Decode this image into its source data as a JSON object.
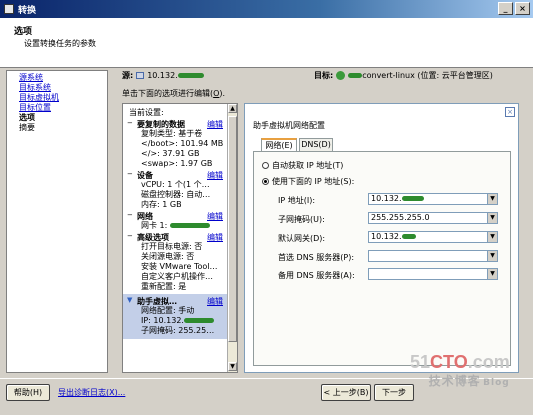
{
  "window": {
    "title": "转换"
  },
  "header": {
    "title": "选项",
    "subtitle": "设置转换任务的参数"
  },
  "nav": {
    "items": [
      {
        "label": "源系统",
        "state": "link"
      },
      {
        "label": "目标系统",
        "state": "link"
      },
      {
        "label": "目标虚拟机",
        "state": "link"
      },
      {
        "label": "目标位置",
        "state": "link"
      },
      {
        "label": "选项",
        "state": "current"
      },
      {
        "label": "摘要",
        "state": "plain"
      }
    ]
  },
  "source": {
    "label": "源:",
    "ip": "10.132."
  },
  "target": {
    "label": "目标:",
    "name": "convert-linux",
    "location": "(位置: 云平台管理区)"
  },
  "hint": {
    "text": "单击下面的选项进行编辑(",
    "key": "O",
    "tail": ")."
  },
  "settings": {
    "current_label": "当前设置:",
    "edit_label": "编辑",
    "sections": [
      {
        "name": "要复制的数据",
        "toggle": "−",
        "rows": [
          "复制类型: 基于卷",
          "</boot>: 101.94 MB",
          "</>: 37.91 GB",
          "<swap>: 1.97 GB"
        ]
      },
      {
        "name": "设备",
        "toggle": "−",
        "rows": [
          "vCPU: 1 个(1 个…",
          "磁盘控制器: 自动…",
          "内存: 1 GB"
        ]
      },
      {
        "name": "网络",
        "toggle": "−",
        "rows": [
          "网卡 1:"
        ]
      },
      {
        "name": "高级选项",
        "toggle": "−",
        "rows": [
          "打开目标电源: 否",
          "关闭源电源: 否",
          "安装 VMware Tool…",
          "自定义客户机操作…",
          "重新配置: 是"
        ]
      },
      {
        "name": "助手虚拟…",
        "toggle": "▼",
        "rows": [
          "网络配置: 手动",
          "IP: 10.132.",
          "子网掩码: 255.25…"
        ]
      }
    ]
  },
  "panel": {
    "title": "助手虚拟机网络配置",
    "tabs": [
      {
        "label": "网络(E)"
      },
      {
        "label": "DNS(D)"
      }
    ],
    "radio_auto": "自动获取 IP 地址(T)",
    "radio_manual": "使用下面的 IP 地址(S):",
    "fields": [
      {
        "label": "IP 地址(I):",
        "value": "10.132."
      },
      {
        "label": "子网掩码(U):",
        "value": "255.255.255.0"
      },
      {
        "label": "默认网关(D):",
        "value": "10.132."
      },
      {
        "label": "首选 DNS 服务器(P):",
        "value": ""
      },
      {
        "label": "备用 DNS 服务器(A):",
        "value": ""
      }
    ]
  },
  "footer": {
    "help": "帮助(H)",
    "export": "导出诊断日志(X)...",
    "back": "< 上一步(B)",
    "next": "下一步"
  },
  "watermark": {
    "line1a": "51",
    "line1b": "CTO",
    "line1c": ".com",
    "line2": "技术博客",
    "line3": "Blog"
  },
  "colors": {
    "accent": "#0a246a",
    "link": "#0000cc",
    "selection": "#c3cfe8"
  }
}
